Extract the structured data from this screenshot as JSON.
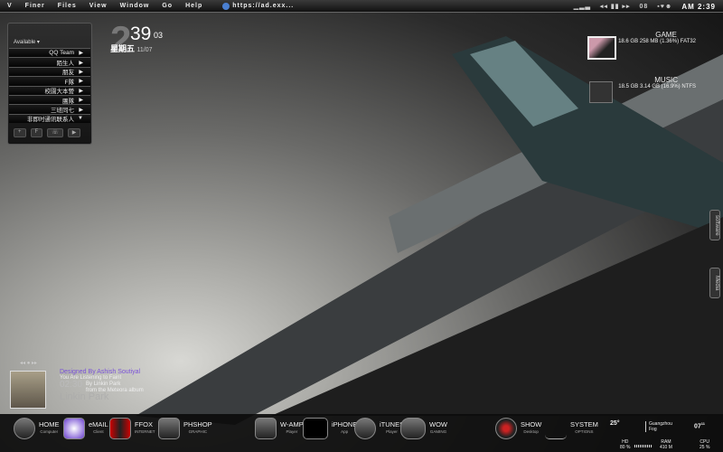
{
  "menubar": {
    "logo": "V",
    "items": [
      "Finer",
      "Files",
      "View",
      "Window",
      "Go",
      "Help"
    ],
    "url": "https://ad.exx...",
    "tray_badge": "08",
    "clock": "AM 2:39"
  },
  "qq": {
    "status": "Available",
    "groups": [
      "QQ Team",
      "陌生人",
      "朋友",
      "F隊",
      "校園大本營",
      "團隊",
      "三班同七",
      "非即时通讯联系人"
    ],
    "buttons": [
      "+",
      "F",
      "☏",
      "▶"
    ]
  },
  "clock": {
    "hour": "2",
    "minute": "39",
    "second": "03",
    "weekday": "星期五",
    "date": "11/07"
  },
  "drives": [
    {
      "name": "GAME",
      "info": "18.6 GB 258 MB  (1.36%)  FAT32"
    },
    {
      "name": "MUSIC",
      "info": "18.5 GB 3.14 GB  (16.9%)  NTFS"
    }
  ],
  "sidetabs": [
    "software",
    "Media"
  ],
  "music": {
    "designer": "Designed By Ashish Soutiyal",
    "listening": "You Are Listening to Faint",
    "artist_by": "By Linkin Park",
    "album": "from the Meteora album",
    "time": "02:30",
    "band": "Linkin Park"
  },
  "dock": [
    {
      "label": "HOME",
      "sub": "Computer"
    },
    {
      "label": "eMAIL",
      "sub": "Client"
    },
    {
      "label": "FFOX",
      "sub": "INTERNET"
    },
    {
      "label": "PHSHOP",
      "sub": "GRAPHIC"
    },
    {
      "label": "W-AMP",
      "sub": "Player"
    },
    {
      "label": "iPHONE",
      "sub": "App"
    },
    {
      "label": "iTUNES",
      "sub": "Player"
    },
    {
      "label": "WOW",
      "sub": "GAMING"
    },
    {
      "label": "SHOW",
      "sub": "Desktop"
    },
    {
      "label": "SYSTEM",
      "sub": "OPTIONS"
    }
  ],
  "weather": {
    "temp": "25°",
    "city": "Guangzhou",
    "cond": "Fog",
    "time": "07",
    "time_sup": "11"
  },
  "stats": {
    "hd_label": "HD",
    "hd": "80 %",
    "ram_label": "RAM",
    "ram": "410 M",
    "cpu_label": "CPU",
    "cpu": "25 %"
  }
}
